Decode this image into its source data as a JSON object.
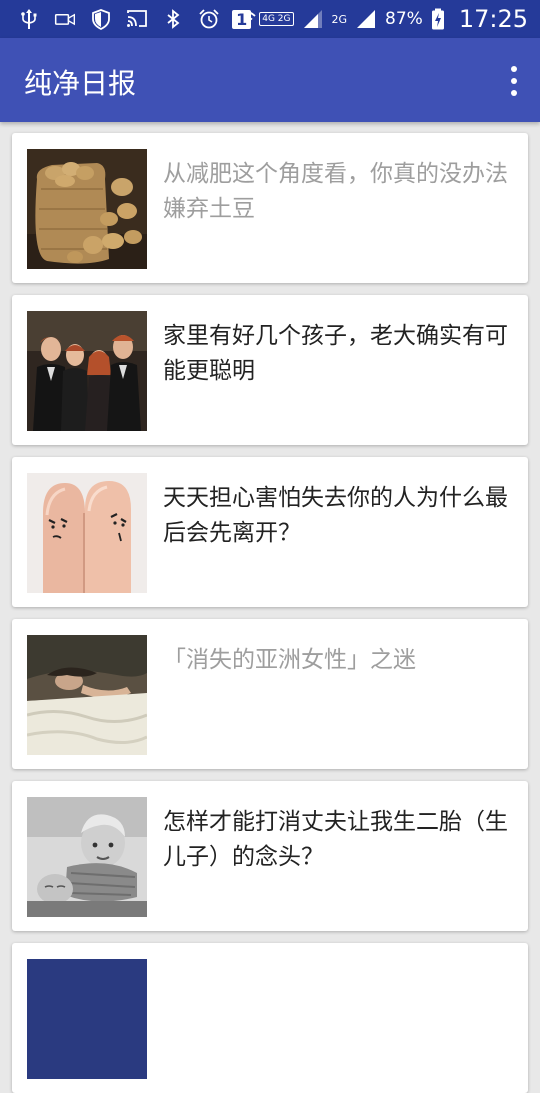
{
  "status_bar": {
    "battery_percent": "87%",
    "time": "17:25",
    "network_4g2g": "4G 2G",
    "network_2g": "2G",
    "sim_slot": "1",
    "icons": [
      "usb-icon",
      "video-icon",
      "shield-icon",
      "cast-icon",
      "bluetooth-icon",
      "alarm-icon",
      "wifi-icon",
      "signal-icon",
      "battery-charging-icon"
    ]
  },
  "app_bar": {
    "title": "纯净日报",
    "menu_icon": "more-vert-icon"
  },
  "feed": {
    "items": [
      {
        "title": "从减肥这个角度看，你真的没办法嫌弃土豆",
        "read": true,
        "thumbnail": "potato-sack-photo"
      },
      {
        "title": "家里有好几个孩子，老大确实有可能更聪明",
        "read": false,
        "thumbnail": "siblings-group-photo"
      },
      {
        "title": "天天担心害怕失去你的人为什么最后会先离开？",
        "read": false,
        "thumbnail": "finger-faces-photo"
      },
      {
        "title": "「消失的亚洲女性」之迷",
        "read": true,
        "thumbnail": "sleeping-woman-photo"
      },
      {
        "title": "怎样才能打消丈夫让我生二胎（生儿子）的念头？",
        "read": false,
        "thumbnail": "babies-photo"
      }
    ]
  },
  "colors": {
    "status_bar": "#253a99",
    "app_bar": "#3f51b5",
    "background": "#e8e8e8",
    "headline_unread": "#222222",
    "headline_read": "#9e9e9e"
  }
}
